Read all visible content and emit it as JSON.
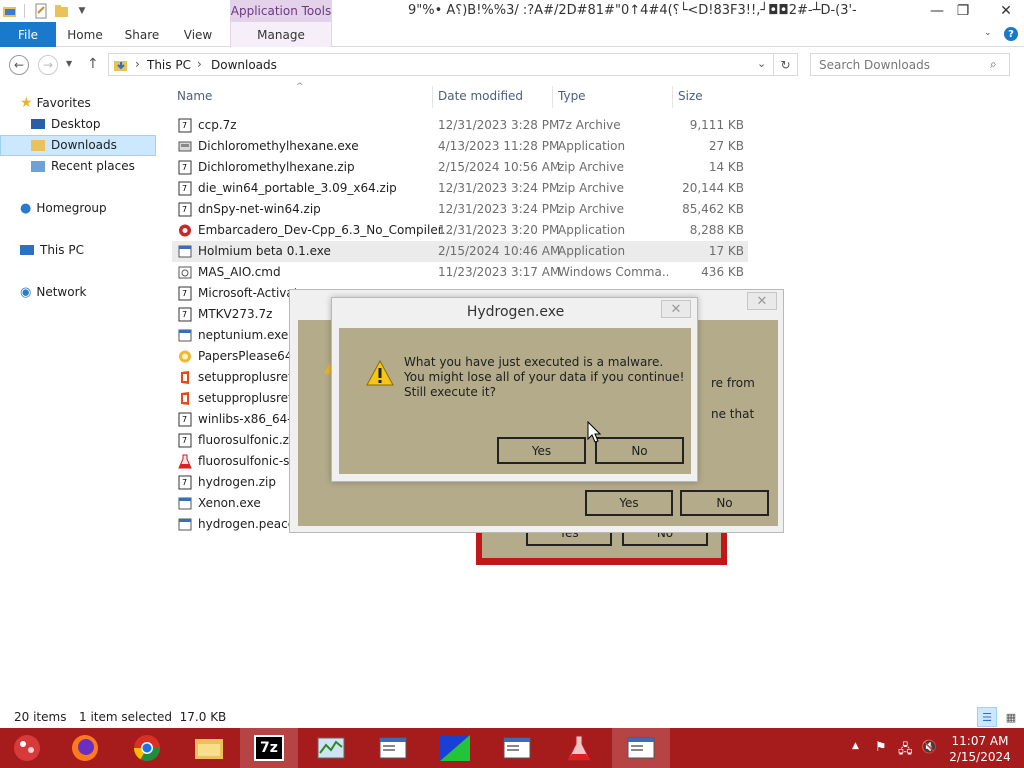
{
  "window": {
    "title": "9\"%• A؟)B!%%3/ :?A#/2D#81#\"؟)4#4↑0└<D!83F3!!,┘◘◘2#-┴D-(3'-",
    "context_tab": "Application Tools"
  },
  "ribbon": {
    "tabs": [
      "File",
      "Home",
      "Share",
      "View",
      "Manage"
    ]
  },
  "address": {
    "crumbs": [
      "This PC",
      "Downloads"
    ],
    "search_placeholder": "Search Downloads"
  },
  "nav": {
    "favorites": "Favorites",
    "desktop": "Desktop",
    "downloads": "Downloads",
    "recent": "Recent places",
    "homegroup": "Homegroup",
    "thispc": "This PC",
    "network": "Network"
  },
  "columns": {
    "name": "Name",
    "date": "Date modified",
    "type": "Type",
    "size": "Size"
  },
  "files": [
    {
      "name": "ccp.7z",
      "date": "12/31/2023 3:28 PM",
      "type": "7z Archive",
      "size": "9,111 KB",
      "icon": "archive-icon"
    },
    {
      "name": "Dichloromethylhexane.exe",
      "date": "4/13/2023 11:28 PM",
      "type": "Application",
      "size": "27 KB",
      "icon": "app-icon"
    },
    {
      "name": "Dichloromethylhexane.zip",
      "date": "2/15/2024 10:56 AM",
      "type": "zip Archive",
      "size": "14 KB",
      "icon": "archive-icon"
    },
    {
      "name": "die_win64_portable_3.09_x64.zip",
      "date": "12/31/2023 3:24 PM",
      "type": "zip Archive",
      "size": "20,144 KB",
      "icon": "archive-icon"
    },
    {
      "name": "dnSpy-net-win64.zip",
      "date": "12/31/2023 3:24 PM",
      "type": "zip Archive",
      "size": "85,462 KB",
      "icon": "archive-icon"
    },
    {
      "name": "Embarcadero_Dev-Cpp_6.3_No_Compiler...",
      "date": "12/31/2023 3:20 PM",
      "type": "Application",
      "size": "8,288 KB",
      "icon": "setup-icon"
    },
    {
      "name": "Holmium beta 0.1.exe",
      "date": "2/15/2024 10:46 AM",
      "type": "Application",
      "size": "17 KB",
      "icon": "window-icon"
    },
    {
      "name": "MAS_AIO.cmd",
      "date": "11/23/2023 3:17 AM",
      "type": "Windows Comma...",
      "size": "436 KB",
      "icon": "gear-icon"
    },
    {
      "name": "Microsoft-Activat",
      "date": "",
      "type": "",
      "size": "",
      "icon": "archive-icon"
    },
    {
      "name": "MTKV273.7z",
      "date": "",
      "type": "",
      "size": "",
      "icon": "archive-icon"
    },
    {
      "name": "neptunium.exe",
      "date": "",
      "type": "",
      "size": "",
      "icon": "window-icon"
    },
    {
      "name": "PapersPlease64.ex",
      "date": "",
      "type": "",
      "size": "",
      "icon": "game-icon"
    },
    {
      "name": "setupproplusretai",
      "date": "",
      "type": "",
      "size": "",
      "icon": "office-icon"
    },
    {
      "name": "setupproplusretai",
      "date": "",
      "type": "",
      "size": "",
      "icon": "office-icon"
    },
    {
      "name": "winlibs-x86_64-pc",
      "date": "",
      "type": "",
      "size": "",
      "icon": "archive-icon"
    },
    {
      "name": "fluorosulfonic.zip",
      "date": "",
      "type": "",
      "size": "",
      "icon": "archive-icon"
    },
    {
      "name": "fluorosulfonic-sa",
      "date": "",
      "type": "",
      "size": "",
      "icon": "flask-icon"
    },
    {
      "name": "hydrogen.zip",
      "date": "",
      "type": "",
      "size": "",
      "icon": "archive-icon"
    },
    {
      "name": "Xenon.exe",
      "date": "",
      "type": "",
      "size": "",
      "icon": "window-icon"
    },
    {
      "name": "hydrogen.peacefu",
      "date": "",
      "type": "",
      "size": "",
      "icon": "window-icon"
    }
  ],
  "status": {
    "count": "20 items",
    "selected": "1 item selected  17.0 KB"
  },
  "dialog_back": {
    "text1": "re from",
    "text2": "ne that",
    "yes": "Yes",
    "no": "No"
  },
  "dialog_red": {
    "yes": "Yes",
    "no": "No"
  },
  "dialog_front": {
    "title": "Hydrogen.exe",
    "line1": "What you have just executed is a malware.",
    "line2": "You might lose all of your data if you continue!",
    "line3": "Still execute it?",
    "yes": "Yes",
    "no": "No"
  },
  "clock": {
    "time": "11:07 AM",
    "date": "2/15/2024"
  },
  "colors": {
    "taskbar": "#a61b1b",
    "dialog_body": "#b3ab8a",
    "accent": "#1979ca"
  }
}
